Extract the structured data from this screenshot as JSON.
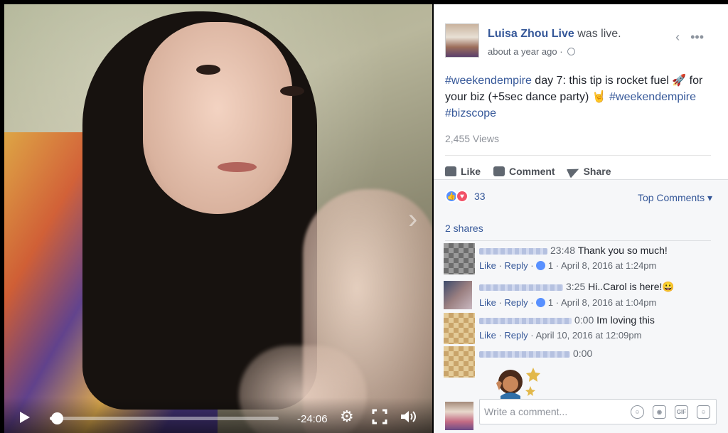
{
  "video": {
    "time_remaining": "-24:06",
    "progress": 0.03,
    "icons": [
      "play-icon",
      "gear-icon",
      "fullscreen-icon",
      "volume-icon"
    ]
  },
  "post": {
    "author": "Luisa Zhou Live",
    "status": "was live.",
    "timestamp": "about a year ago",
    "separator": "·",
    "text_parts": [
      {
        "text": "#weekendempire",
        "type": "hashtag"
      },
      {
        "text": " day 7: this tip is rocket fuel 🚀 for your biz (+5sec dance party) 🤘 ",
        "type": "plain"
      },
      {
        "text": "#weekendempire",
        "type": "hashtag"
      },
      {
        "text": " ",
        "type": "plain"
      },
      {
        "text": "#bizscope",
        "type": "hashtag"
      }
    ],
    "views": "2,455 Views"
  },
  "actions": {
    "like": "Like",
    "comment": "Comment",
    "share": "Share"
  },
  "reactions": {
    "count": "33",
    "sort_label": "Top Comments ▾",
    "shares": "2 shares"
  },
  "comments": [
    {
      "video_time": "23:48",
      "text": "Thank you so much!",
      "like": "Like",
      "reply": "Reply",
      "likes": "1",
      "date": "April 8, 2016 at 1:24pm"
    },
    {
      "video_time": "3:25",
      "text": "Hi..Carol is here!😀",
      "like": "Like",
      "reply": "Reply",
      "likes": "1",
      "date": "April 8, 2016 at 1:04pm"
    },
    {
      "video_time": "0:00",
      "text": "Im loving this",
      "like": "Like",
      "reply": "Reply",
      "likes": "",
      "date": "April 10, 2016 at 12:09pm"
    },
    {
      "video_time": "0:00",
      "text": "",
      "like": "",
      "reply": "",
      "likes": "",
      "date": ""
    }
  ],
  "composer": {
    "placeholder": "Write a comment...",
    "icons": [
      "smiley-icon",
      "camera-icon",
      "gif-icon",
      "sticker-icon"
    ],
    "gif_label": "GIF"
  },
  "colors": {
    "link": "#365899",
    "like_blue": "#5890ff",
    "love_red": "#f25268"
  }
}
